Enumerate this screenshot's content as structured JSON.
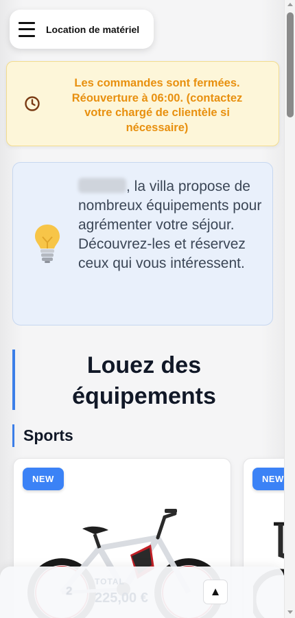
{
  "header": {
    "title": "Location de matériel",
    "menu_icon": "hamburger-menu-icon"
  },
  "alert": {
    "icon": "clock-icon",
    "message": "Les commandes sont fermées. Réouverture à 06:00. (contactez votre chargé de clientèle si nécessaire)",
    "color": "#e8900f"
  },
  "info": {
    "icon": "lightbulb-icon",
    "text": ", la villa propose de nombreux équipements pour agrémenter votre séjour. Découvrez-les et réservez ceux qui vous intéressent."
  },
  "main": {
    "title": "Louez des équipements",
    "category": "Sports",
    "products": [
      {
        "badge": "NEW",
        "image": "electric-bike-image"
      },
      {
        "badge": "NEW",
        "image": "electric-bike-image"
      }
    ]
  },
  "cart": {
    "count": "2",
    "total_label": "TOTAL",
    "total_value": "225,00 €",
    "scroll_top_label": "▲"
  },
  "colors": {
    "accent": "#3b82f6",
    "alert_bg": "#fdf6d9",
    "info_bg": "#e9f0fb"
  }
}
